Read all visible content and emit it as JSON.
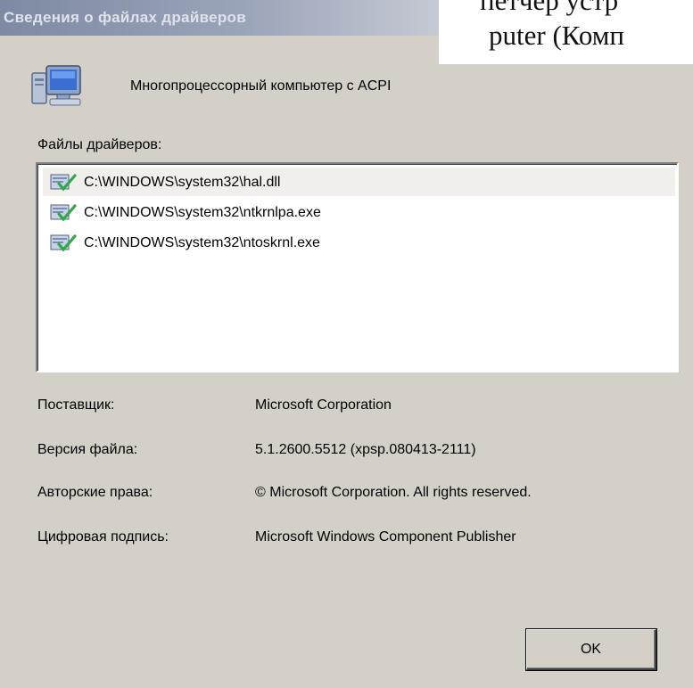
{
  "dialog": {
    "title": "Сведения о файлах драйверов",
    "device_name": "Многопроцессорный компьютер с ACPI",
    "files_label": "Файлы драйверов:",
    "files": [
      "C:\\WINDOWS\\system32\\hal.dll",
      "C:\\WINDOWS\\system32\\ntkrnlpa.exe",
      "C:\\WINDOWS\\system32\\ntoskrnl.exe"
    ],
    "selected_file_index": 0,
    "properties": [
      {
        "label": "Поставщик:",
        "value": "Microsoft Corporation"
      },
      {
        "label": "Версия файла:",
        "value": "5.1.2600.5512 (xpsp.080413-2111)"
      },
      {
        "label": "Авторские права:",
        "value": "© Microsoft Corporation. All rights reserved."
      },
      {
        "label": "Цифровая подпись:",
        "value": "Microsoft Windows Component Publisher"
      }
    ],
    "ok_label": "OK"
  },
  "slide_text": {
    "line1": "петчер устр",
    "line2": "puter (Комп"
  },
  "icons": {
    "device": "computer-icon",
    "file": "signed-driver-file-icon"
  },
  "colors": {
    "dialog_bg": "#d4d0c8",
    "slide_bg": "#0d1250",
    "titlebar_inactive": "#9aa4b9",
    "checkmark": "#2fa84a"
  }
}
